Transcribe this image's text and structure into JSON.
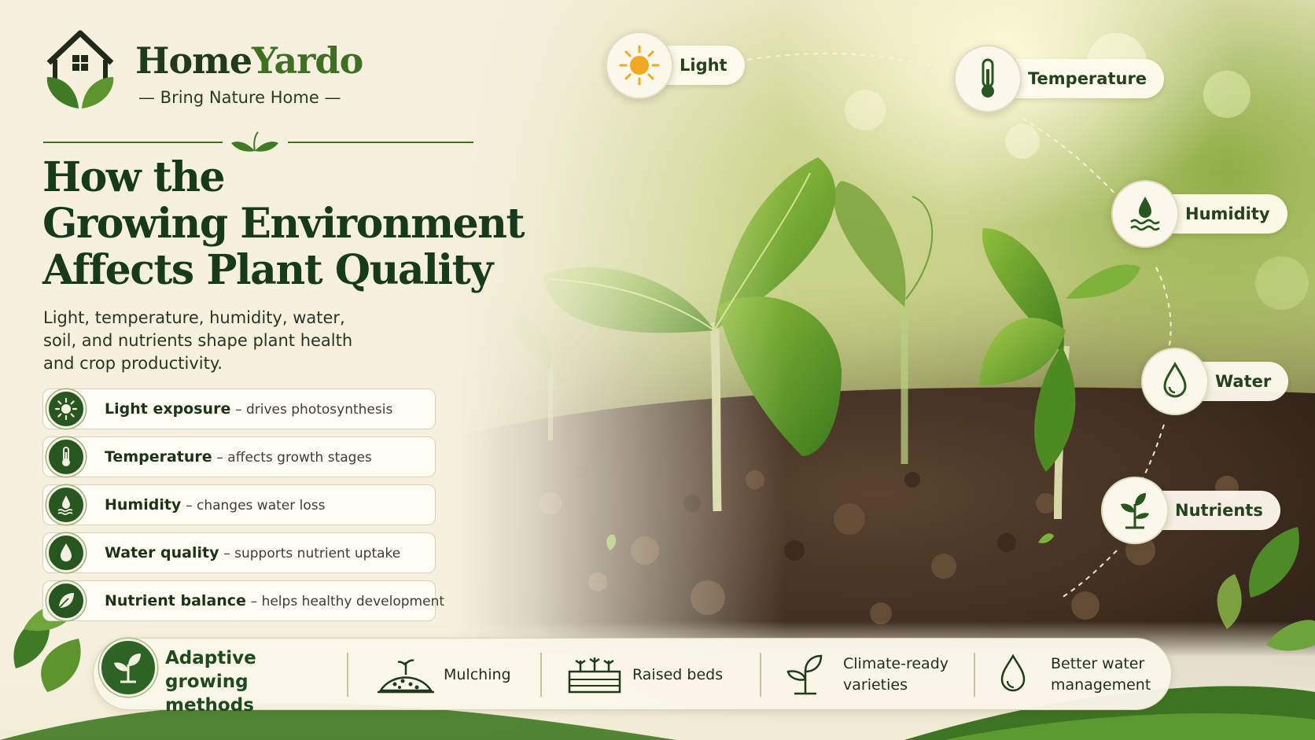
{
  "brand": {
    "name_part1": "Home",
    "name_part2": "Yardo",
    "tagline": "— Bring Nature Home —"
  },
  "headline": {
    "line1": "How the",
    "line2": "Growing Environment",
    "line3": "Affects Plant Quality"
  },
  "intro": "Light, temperature, humidity, water, soil, and nutrients shape plant health and crop productivity.",
  "factors": [
    {
      "name": "Light exposure",
      "desc": "– drives photosynthesis",
      "icon": "sun-icon"
    },
    {
      "name": "Temperature",
      "desc": "– affects growth stages",
      "icon": "thermometer-icon"
    },
    {
      "name": "Humidity",
      "desc": "– changes water loss",
      "icon": "humidity-icon"
    },
    {
      "name": "Water quality",
      "desc": "– supports nutrient uptake",
      "icon": "water-drop-icon"
    },
    {
      "name": "Nutrient balance",
      "desc": "– helps healthy development",
      "icon": "leaf-icon"
    }
  ],
  "callouts": {
    "light": "Light",
    "temperature": "Temperature",
    "humidity": "Humidity",
    "water": "Water",
    "nutrients": "Nutrients"
  },
  "methods": {
    "title": "Adaptive growing methods",
    "items": [
      {
        "label": "Mulching",
        "icon": "mulch-icon"
      },
      {
        "label": "Raised beds",
        "icon": "raised-bed-icon"
      },
      {
        "label": "Climate-ready varieties",
        "icon": "sprout-icon"
      },
      {
        "label": "Better water management",
        "icon": "water-drop-icon"
      }
    ]
  },
  "colors": {
    "brand_green": "#27561f",
    "accent_green": "#3f6f22",
    "cream": "#f6f0de",
    "sun": "#f2a820"
  }
}
